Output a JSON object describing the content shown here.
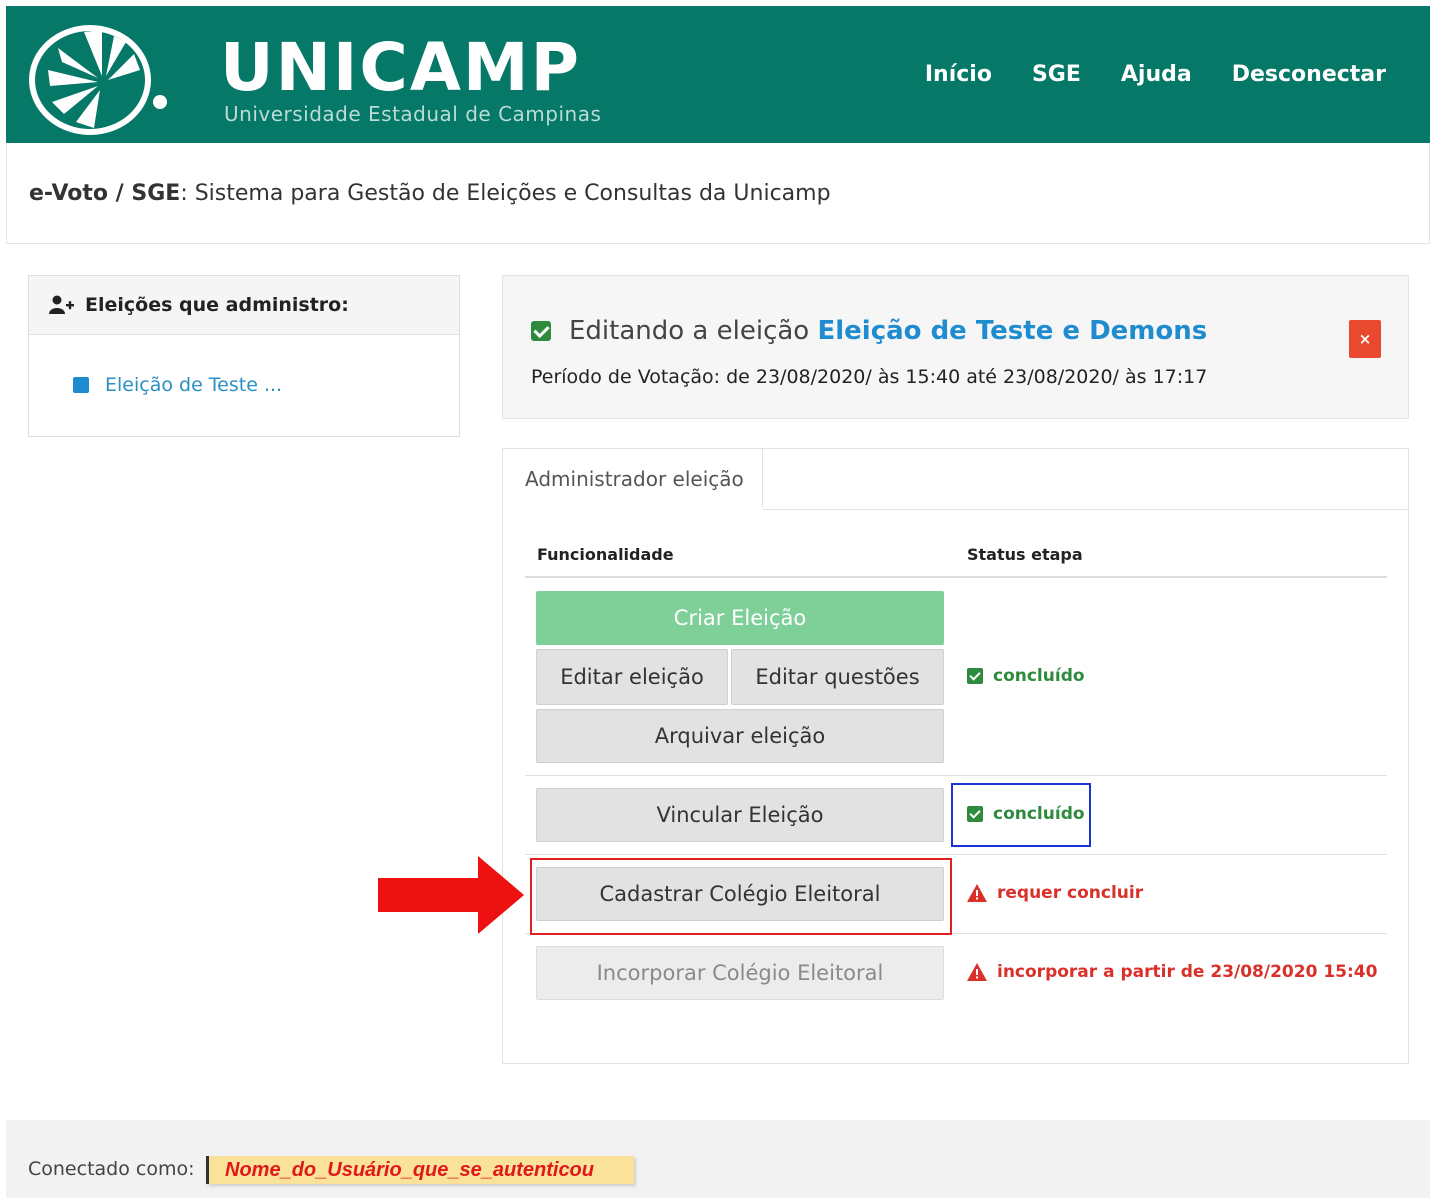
{
  "header": {
    "brand_title": "UNICAMP",
    "brand_subtitle": "Universidade Estadual de Campinas",
    "nav": [
      "Início",
      "SGE",
      "Ajuda",
      "Desconectar"
    ],
    "bg_color": "#057868"
  },
  "subtitle": {
    "strong": "e-Voto / SGE",
    "text": ": Sistema para Gestão de Eleições e Consultas da Unicamp"
  },
  "sidebar": {
    "icon": "user-plus-icon",
    "title": "Eleições que administro:",
    "items": [
      {
        "label": "Eleição de Teste ...",
        "icon": "square-icon"
      }
    ]
  },
  "edit_panel": {
    "prefix": "Editando a eleição",
    "election_name": "Eleição de Teste e Demons",
    "period": "Período de Votação: de 23/08/2020/ às 15:40 até 23/08/2020/ às 17:17",
    "close_label": "×"
  },
  "tabs": [
    {
      "label": "Administrador eleição",
      "active": true
    }
  ],
  "table": {
    "headers": [
      "Funcionalidade",
      "Status etapa"
    ],
    "rows": [
      {
        "buttons": [
          "Criar Eleição",
          "Editar eleição",
          "Editar questões",
          "Arquivar eleição"
        ],
        "status": "concluído",
        "status_type": "ok"
      },
      {
        "buttons": [
          "Vincular Eleição"
        ],
        "status": "concluído",
        "status_type": "ok"
      },
      {
        "buttons": [
          "Cadastrar Colégio Eleitoral"
        ],
        "status": "requer concluir",
        "status_type": "warn"
      },
      {
        "buttons": [
          "Incorporar Colégio Eleitoral"
        ],
        "status": "incorporar a partir de 23/08/2020 15:40",
        "status_type": "warn"
      }
    ]
  },
  "footer": {
    "label": "Conectado como:",
    "user": "Nome_do_Usuário_que_se_autenticou"
  },
  "colors": {
    "ok": "#2e8b3d",
    "warn": "#d9302a",
    "link": "#1f8ccf",
    "close": "#e94a2f"
  }
}
